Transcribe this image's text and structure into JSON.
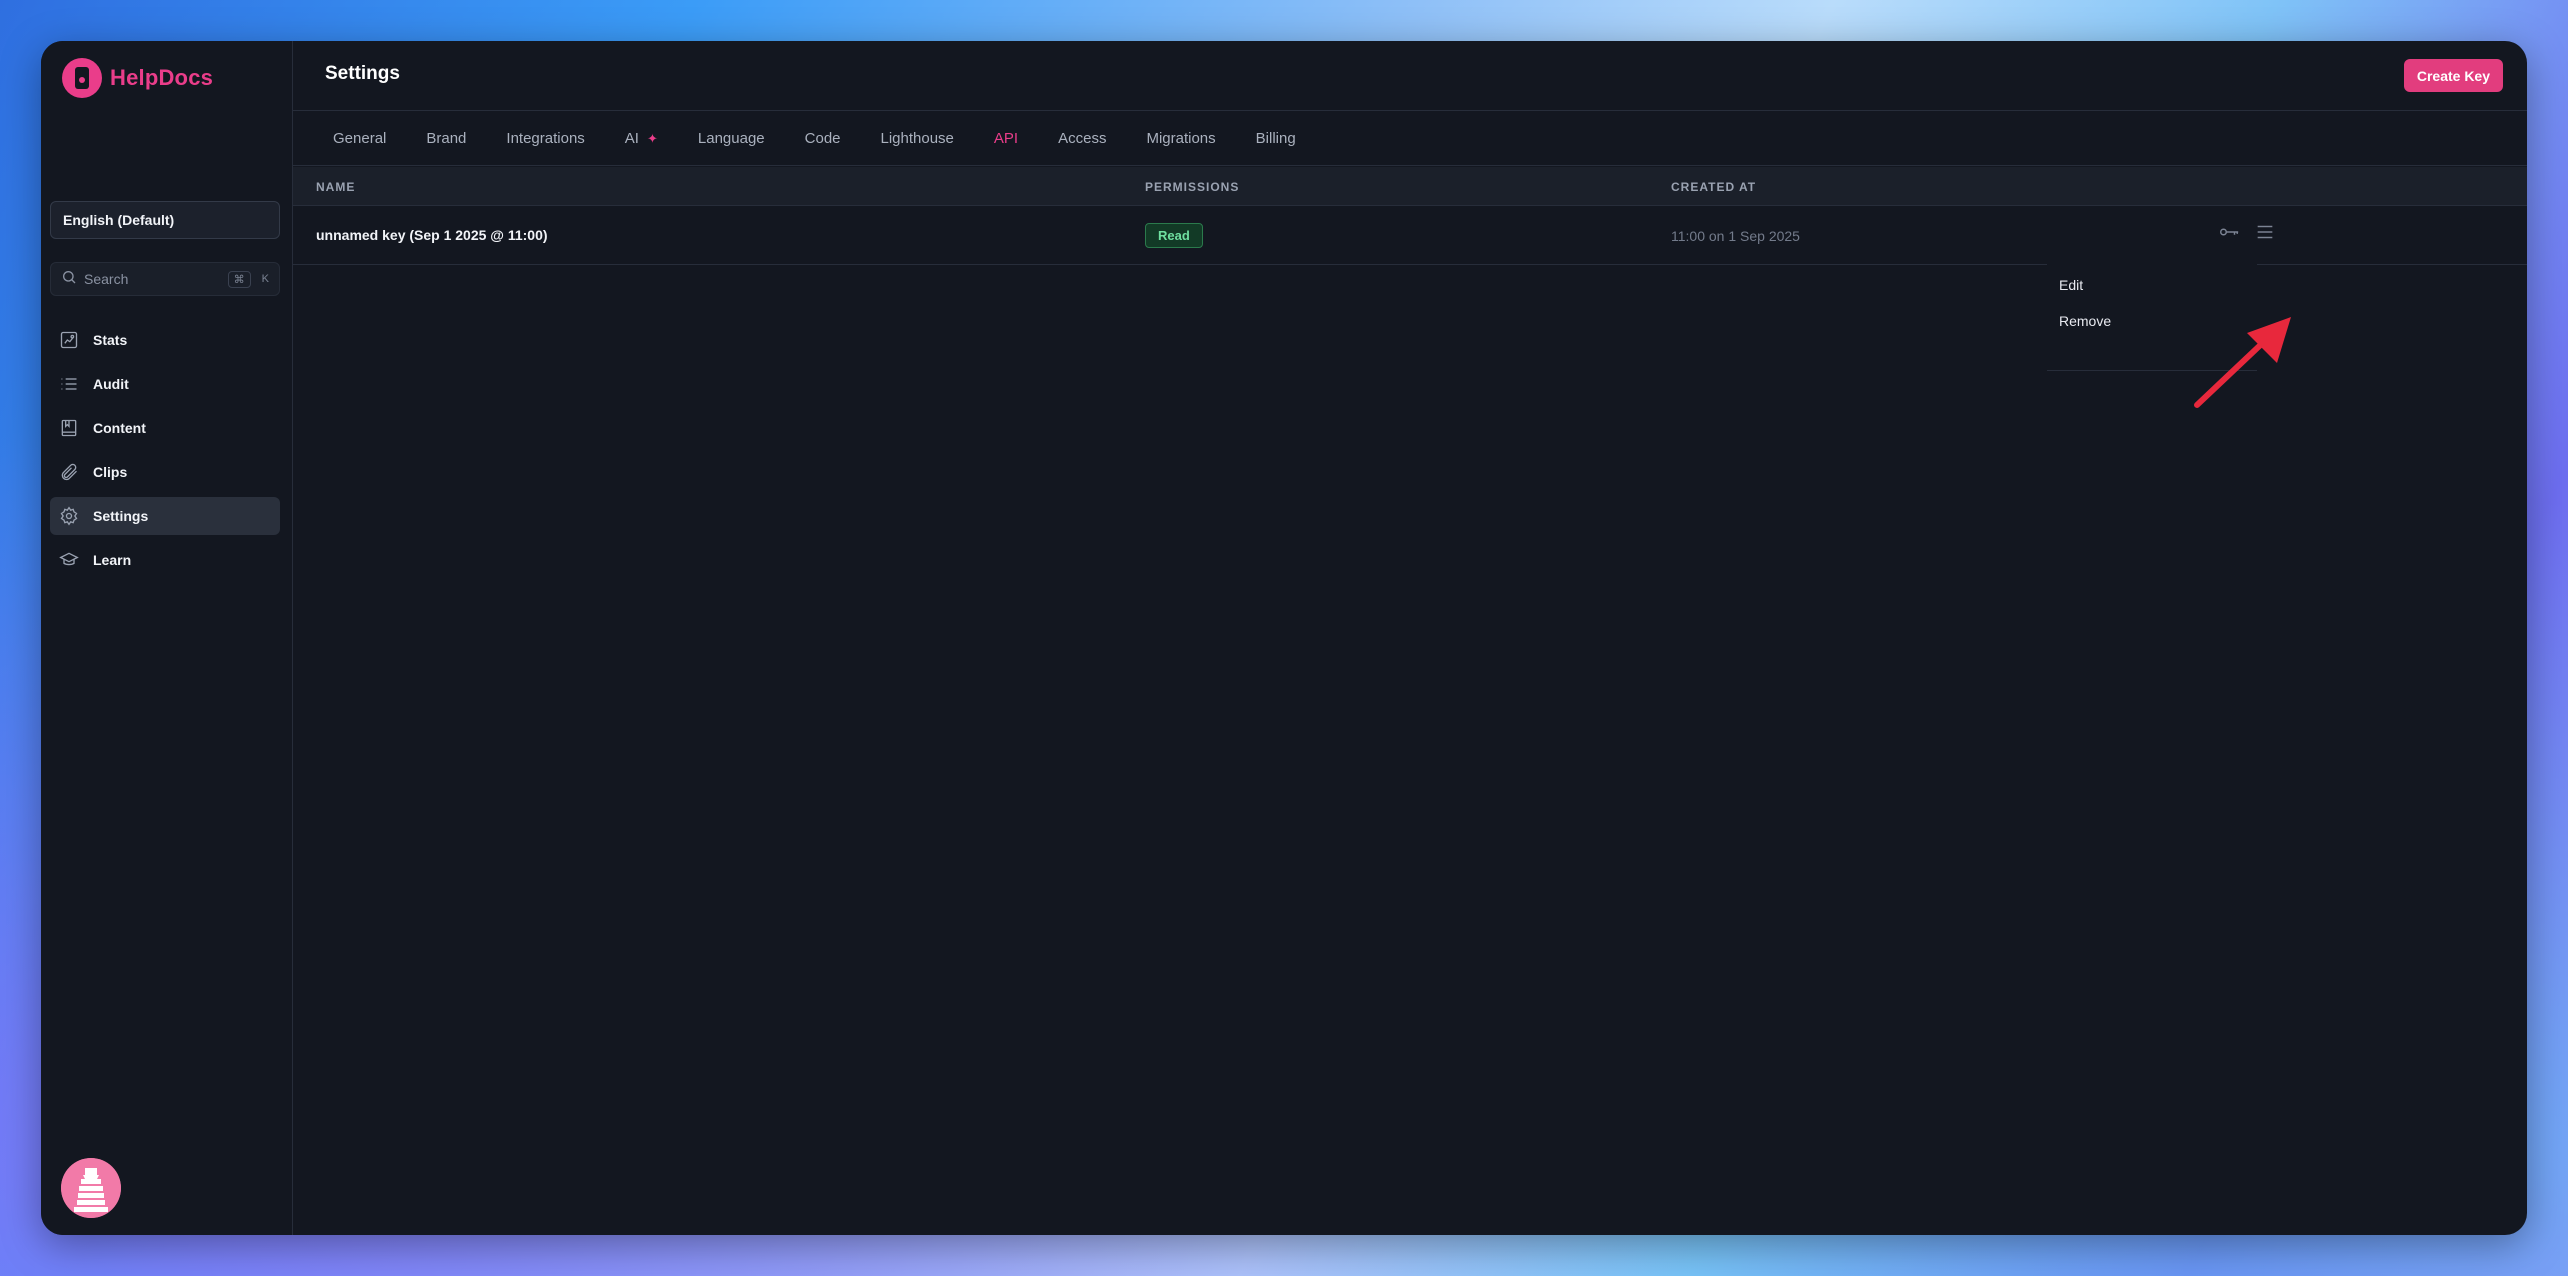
{
  "app": {
    "name": "HelpDocs",
    "brand_color": "#ea3d8a"
  },
  "sidebar": {
    "language": "English (Default)",
    "search": {
      "placeholder": "Search",
      "shortcut_key": "⌘",
      "shortcut_letter": "K"
    },
    "items": [
      {
        "label": "Stats",
        "icon": "stats-icon"
      },
      {
        "label": "Audit",
        "icon": "list-icon"
      },
      {
        "label": "Content",
        "icon": "book-icon"
      },
      {
        "label": "Clips",
        "icon": "paperclip-icon"
      },
      {
        "label": "Settings",
        "icon": "gear-icon",
        "active": true
      },
      {
        "label": "Learn",
        "icon": "graduation-cap-icon"
      }
    ]
  },
  "header": {
    "title": "Settings",
    "create_button": "Create Key"
  },
  "tabs": [
    "General",
    "Brand",
    "Integrations",
    "AI",
    "Language",
    "Code",
    "Lighthouse",
    "API",
    "Access",
    "Migrations",
    "Billing"
  ],
  "active_tab": "API",
  "table": {
    "columns": [
      "NAME",
      "PERMISSIONS",
      "CREATED AT"
    ],
    "rows": [
      {
        "name": "unnamed key (Sep 1 2025 @ 11:00)",
        "permission": "Read",
        "created_at": "11:00 on 1 Sep 2025"
      }
    ]
  },
  "row_menu": {
    "items": [
      "Edit",
      "Remove"
    ]
  },
  "colors": {
    "accent": "#e23d7e",
    "badge_green": "#6fe0a0",
    "annotation_arrow": "#e8283c"
  }
}
